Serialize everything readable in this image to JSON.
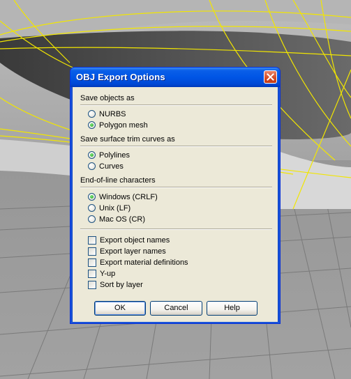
{
  "dialog": {
    "title": "OBJ Export Options",
    "close_icon": "close-icon"
  },
  "save_objects": {
    "heading": "Save objects as",
    "options": [
      {
        "label": "NURBS",
        "selected": false
      },
      {
        "label": "Polygon mesh",
        "selected": true
      }
    ]
  },
  "trim_curves": {
    "heading": "Save surface trim curves as",
    "options": [
      {
        "label": "Polylines",
        "selected": true
      },
      {
        "label": "Curves",
        "selected": false
      }
    ]
  },
  "eol": {
    "heading": "End-of-line characters",
    "options": [
      {
        "label": "Windows (CRLF)",
        "selected": true
      },
      {
        "label": "Unix (LF)",
        "selected": false
      },
      {
        "label": "Mac OS (CR)",
        "selected": false
      }
    ]
  },
  "checkboxes": [
    {
      "label": "Export object names",
      "checked": false
    },
    {
      "label": "Export layer names",
      "checked": false
    },
    {
      "label": "Export material definitions",
      "checked": false
    },
    {
      "label": "Y-up",
      "checked": false
    },
    {
      "label": "Sort by layer",
      "checked": false
    }
  ],
  "buttons": {
    "ok": "OK",
    "cancel": "Cancel",
    "help": "Help"
  },
  "colors": {
    "title_bar": "#0055e5",
    "dialog_bg": "#ece9d8",
    "viewport_grid": "#8a8a8a",
    "curve_highlight": "#f2e600"
  }
}
